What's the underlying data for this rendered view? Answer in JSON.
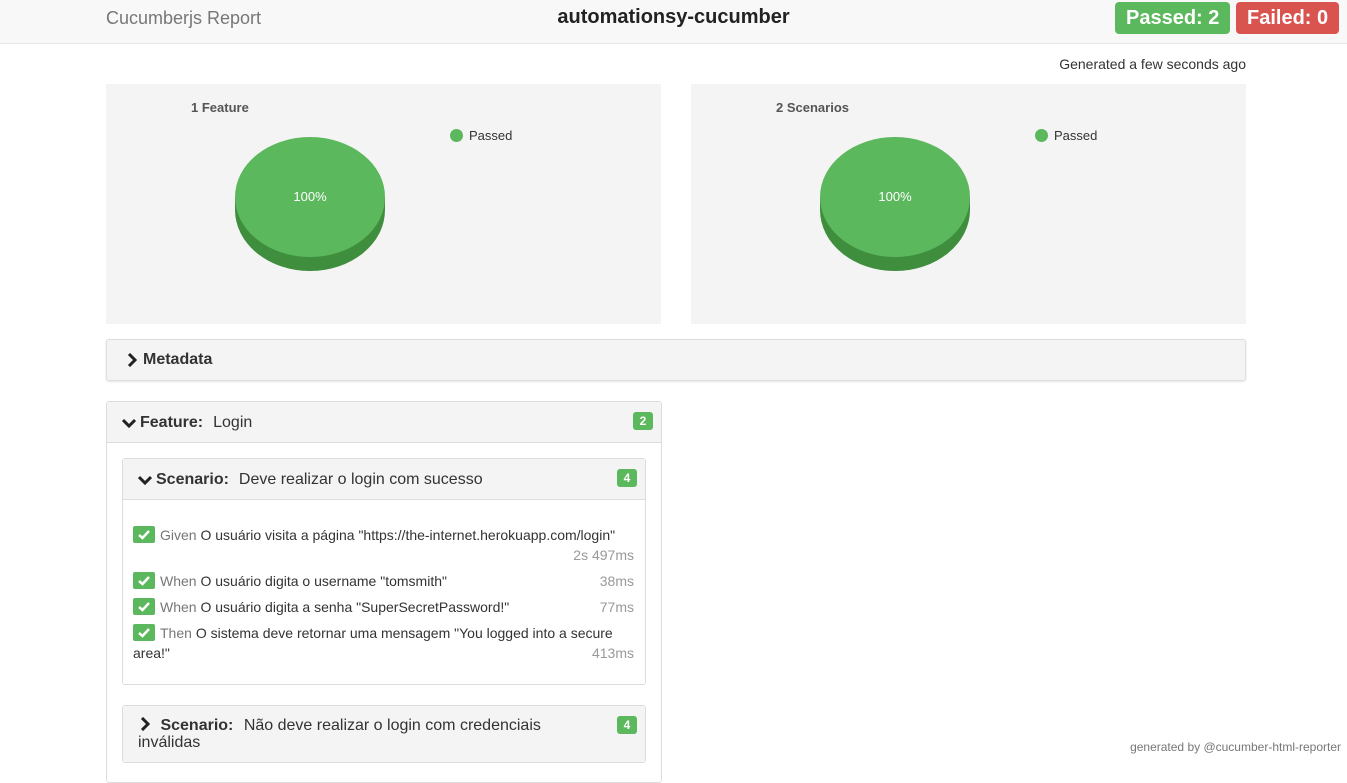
{
  "header": {
    "brand": "Cucumberjs Report",
    "project": "automationsy-cucumber",
    "passed_label": "Passed: 2",
    "failed_label": "Failed: 0"
  },
  "generated": "Generated a few seconds ago",
  "charts": [
    {
      "title": "1 Feature",
      "legend": "Passed",
      "slice_label": "100%",
      "color": "#5cb85c"
    },
    {
      "title": "2 Scenarios",
      "legend": "Passed",
      "slice_label": "100%",
      "color": "#5cb85c"
    }
  ],
  "chart_data": [
    {
      "type": "pie",
      "title": "1 Feature",
      "categories": [
        "Passed"
      ],
      "values": [
        100
      ],
      "unit": "%",
      "legend": "top-right"
    },
    {
      "type": "pie",
      "title": "2 Scenarios",
      "categories": [
        "Passed"
      ],
      "values": [
        100
      ],
      "unit": "%",
      "legend": "top-right"
    }
  ],
  "metadata": {
    "label": "Metadata"
  },
  "feature": {
    "keyword": "Feature:",
    "name": "Login",
    "count": "2",
    "scenarios": [
      {
        "keyword": "Scenario:",
        "name": "Deve realizar o login com sucesso",
        "count": "4",
        "steps": [
          {
            "keyword": "Given",
            "text": "O usuário visita a página \"https://the-internet.herokuapp.com/login\"",
            "duration": "2s 497ms"
          },
          {
            "keyword": "When",
            "text": "O usuário digita o username \"tomsmith\"",
            "duration": "38ms"
          },
          {
            "keyword": "When",
            "text": "O usuário digita a senha \"SuperSecretPassword!\"",
            "duration": "77ms"
          },
          {
            "keyword": "Then",
            "text": "O sistema deve retornar uma mensagem \"You logged into a secure area!\"",
            "duration": "413ms"
          }
        ]
      },
      {
        "keyword": "Scenario:",
        "name": "Não deve realizar o login com credenciais inválidas",
        "count": "4"
      }
    ]
  },
  "colors": {
    "passed": "#5cb85c",
    "failed": "#d9534f"
  },
  "footer": "generated by @cucumber-html-reporter"
}
